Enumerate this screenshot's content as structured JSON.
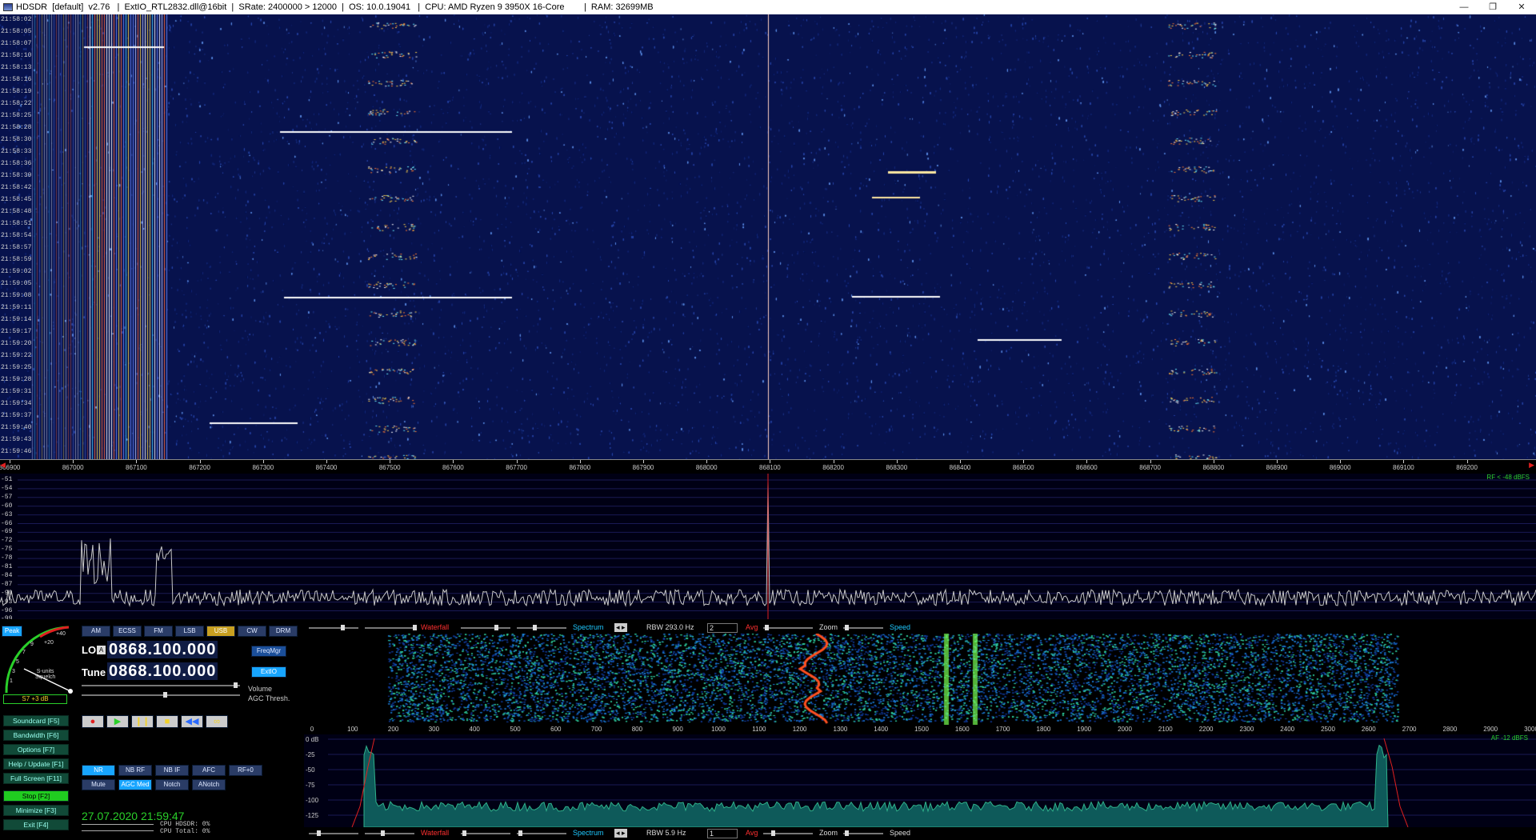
{
  "window": {
    "title": "HDSDR  [default]  v2.76   |  ExtIO_RTL2832.dll@16bit  |  SRate: 2400000 > 12000  |  OS: 10.0.19041   |  CPU: AMD Ryzen 9 3950X 16-Core        |  RAM: 32699MB",
    "controls": [
      "—",
      "❐",
      "✕"
    ]
  },
  "waterfall": {
    "time_labels": [
      "21:58:02",
      "21:58:05",
      "21:58:07",
      "21:58:10",
      "21:58:13",
      "21:58:16",
      "21:58:19",
      "21:58:22",
      "21:58:25",
      "21:58:28",
      "21:58:30",
      "21:58:33",
      "21:58:36",
      "21:58:39",
      "21:58:42",
      "21:58:45",
      "21:58:48",
      "21:58:51",
      "21:58:54",
      "21:58:57",
      "21:58:59",
      "21:59:02",
      "21:59:05",
      "21:59:08",
      "21:59:11",
      "21:59:14",
      "21:59:17",
      "21:59:20",
      "21:59:22",
      "21:59:25",
      "21:59:28",
      "21:59:31",
      "21:59:34",
      "21:59:37",
      "21:59:40",
      "21:59:43",
      "21:59:46"
    ]
  },
  "freq_axis": {
    "labels": [
      "866900",
      "867000",
      "867100",
      "867200",
      "867300",
      "867400",
      "867500",
      "867600",
      "867700",
      "867800",
      "867900",
      "868000",
      "868100",
      "868200",
      "868300",
      "868400",
      "868500",
      "868600",
      "868700",
      "868800",
      "868900",
      "869000",
      "869100",
      "869200"
    ]
  },
  "spectrum": {
    "db_labels": [
      "-51",
      "-54",
      "-57",
      "-60",
      "-63",
      "-66",
      "-69",
      "-72",
      "-75",
      "-78",
      "-81",
      "-84",
      "-87",
      "-90",
      "-93",
      "-96",
      "-99"
    ],
    "rf_label": "RF < -48 dBFS"
  },
  "modes": [
    "AM",
    "ECSS",
    "FM",
    "LSB",
    "USB",
    "CW",
    "DRM"
  ],
  "active_mode": "USB",
  "smeter": {
    "peak_label": "Peak",
    "scale": [
      "+20",
      "+40",
      "9",
      "7",
      "5",
      "3",
      "1"
    ],
    "caption": "S-units\nSquelch",
    "value": "S7 +3 dB"
  },
  "lo": {
    "label": "LO",
    "marker": "A",
    "value": "0868.100.000",
    "btn": "FreqMgr"
  },
  "tune": {
    "label": "Tune",
    "value": "0868.100.000",
    "btn": "ExtIO"
  },
  "volume_label": "Volume",
  "agc_label": "AGC Thresh.",
  "transport": [
    "●",
    "▶",
    "❙❙",
    "■",
    "◀◀",
    "∞"
  ],
  "left_buttons": [
    "Soundcard  [F5]",
    "Bandwidth  [F6]",
    "Options  [F7]",
    "Help / Update  [F1]",
    "Full Screen  [F11]",
    "Stop  [F2]",
    "Minimize  [F3]",
    "Exit  [F4]"
  ],
  "dsp_row1": [
    "NR",
    "NB RF",
    "NB IF",
    "AFC",
    "RF+0"
  ],
  "dsp_row2": [
    "Mute",
    "AGC Med",
    "Notch",
    "ANotch"
  ],
  "clock": "27.07.2020 21:59:47",
  "cpu": {
    "hdsdr": "CPU HDSDR:  0%",
    "total": "CPU Total:  0%"
  },
  "toolbar_top": {
    "waterfall": "Waterfall",
    "spectrum": "Spectrum",
    "rbw": "RBW  293.0 Hz",
    "rbw_sel": "2",
    "avg": "Avg",
    "zoom": "Zoom",
    "speed": "Speed"
  },
  "toolbar_bottom": {
    "waterfall": "Waterfall",
    "spectrum": "Spectrum",
    "rbw": "RBW   5.9 Hz",
    "rbw_sel": "1",
    "avg": "Avg",
    "zoom": "Zoom",
    "speed": "Speed"
  },
  "audio_axis": [
    "0",
    "100",
    "200",
    "300",
    "400",
    "500",
    "600",
    "700",
    "800",
    "900",
    "1000",
    "1100",
    "1200",
    "1300",
    "1400",
    "1500",
    "1600",
    "1700",
    "1800",
    "1900",
    "2000",
    "2100",
    "2200",
    "2300",
    "2400",
    "2500",
    "2600",
    "2700",
    "2800",
    "2900",
    "3000"
  ],
  "audio_spec": {
    "db_labels": [
      "0 dB",
      "-25",
      "-50",
      "-75",
      "-100",
      "-125"
    ],
    "af_label": "AF -12 dBFS"
  },
  "colors": {
    "waterfall_bg": "#07124d",
    "spectrum_line": "#c8c8c8",
    "active": "#17a5ff",
    "stop": "#20cc20"
  }
}
